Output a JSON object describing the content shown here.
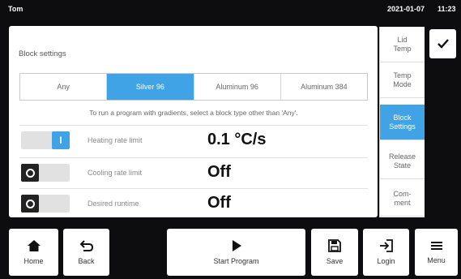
{
  "status": {
    "user": "Tom",
    "date": "2021-01-07",
    "time": "11:23"
  },
  "panel": {
    "title": "Block settings",
    "block_types": [
      {
        "label": "Any",
        "selected": false
      },
      {
        "label": "Silver 96",
        "selected": true
      },
      {
        "label": "Aluminum 96",
        "selected": false
      },
      {
        "label": "Aluminum 384",
        "selected": false
      }
    ],
    "hint": "To run a program with gradients, select a block type other than 'Any'.",
    "rows": [
      {
        "label": "Heating rate limit",
        "value": "0.1 °C/s",
        "toggle": "on",
        "knob_glyph": "I"
      },
      {
        "label": "Cooling rate limit",
        "value": "Off",
        "toggle": "off"
      },
      {
        "label": "Desired runtime",
        "value": "Off",
        "toggle": "off"
      }
    ]
  },
  "tabs": [
    {
      "label": "Lid\nTemp",
      "active": false
    },
    {
      "label": "Temp\nMode",
      "active": false
    },
    {
      "label": "Block\nSettings",
      "active": true
    },
    {
      "label": "Release\nState",
      "active": false
    },
    {
      "label": "Com-\nment",
      "active": false
    }
  ],
  "confirm": {
    "icon": "checkmark-icon"
  },
  "bottom": {
    "home": {
      "label": "Home",
      "icon": "home-icon"
    },
    "back": {
      "label": "Back",
      "icon": "back-arrow-icon"
    },
    "start": {
      "label": "Start Program",
      "icon": "play-icon"
    },
    "save": {
      "label": "Save",
      "icon": "save-icon"
    },
    "login": {
      "label": "Login",
      "icon": "login-icon"
    },
    "menu": {
      "label": "Menu",
      "icon": "menu-icon"
    }
  },
  "colors": {
    "accent": "#3fa3e6",
    "background": "#0d0d0f"
  }
}
